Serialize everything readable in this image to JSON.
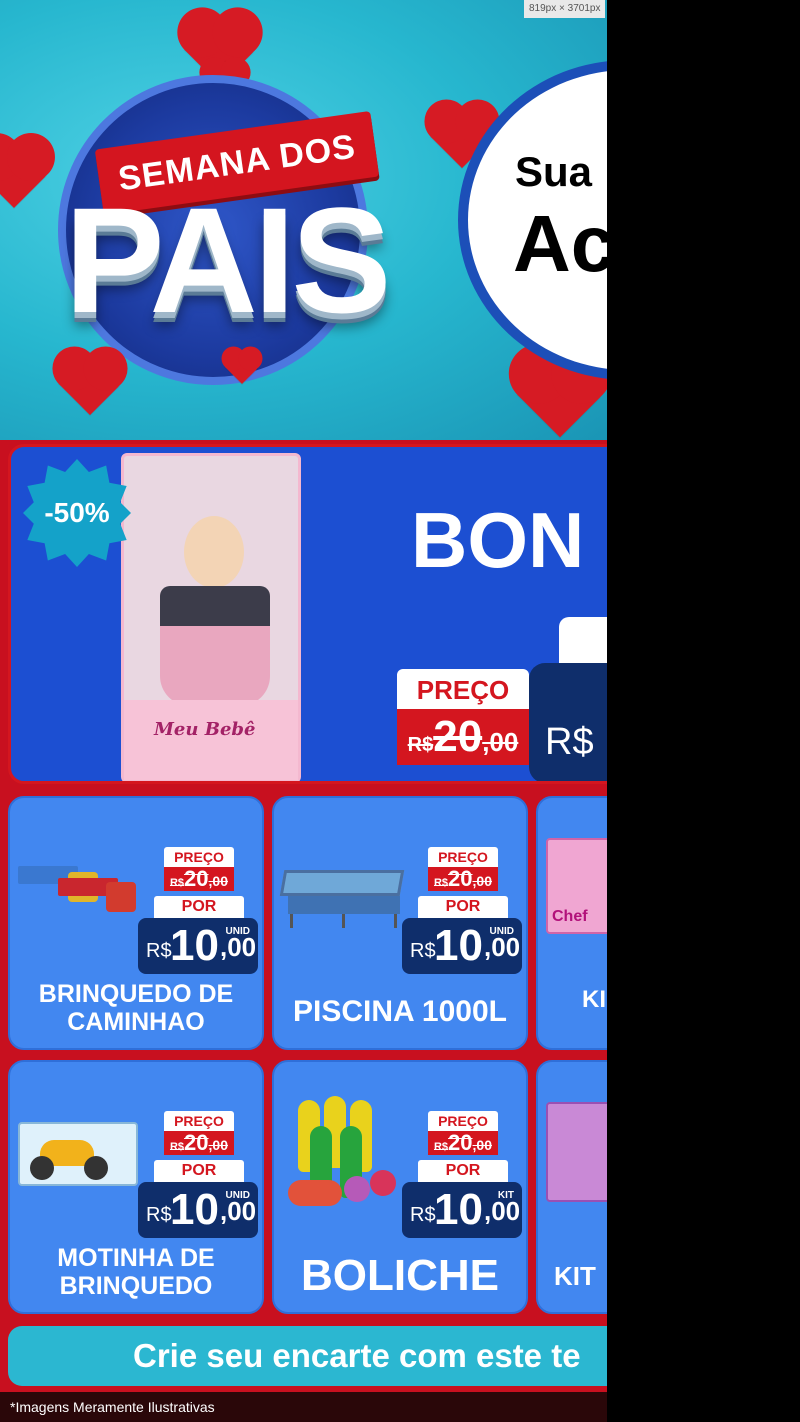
{
  "viewer": {
    "dimensions_label": "819px × 3701px"
  },
  "header": {
    "logo_banner": "SEMANA DOS",
    "logo_main": "PAIS",
    "circle_line1": "Sua",
    "circle_line2": "Ac"
  },
  "featured": {
    "discount": "-50%",
    "box_label": "Meu Bebê",
    "name": "BON",
    "preco_label": "PREÇO",
    "old_currency": "R$",
    "old_price": "20",
    "old_cents": ",00",
    "new_currency": "R$"
  },
  "products": [
    {
      "title": "BRINQUEDO DE CAMINHAO",
      "preco": "PREÇO",
      "old_currency": "R$",
      "old_price": "20",
      "old_cents": ",00",
      "por": "POR",
      "new_currency": "R$",
      "new_price": "10",
      "new_cents": ",00",
      "unit": "UNID"
    },
    {
      "title": "PISCINA 1000L",
      "preco": "PREÇO",
      "old_currency": "R$",
      "old_price": "20",
      "old_cents": ",00",
      "por": "POR",
      "new_currency": "R$",
      "new_price": "10",
      "new_cents": ",00",
      "unit": "UNID"
    },
    {
      "title": "KI",
      "box_label": "Chef"
    },
    {
      "title": "MOTINHA DE BRINQUEDO",
      "preco": "PREÇO",
      "old_currency": "R$",
      "old_price": "20",
      "old_cents": ",00",
      "por": "POR",
      "new_currency": "R$",
      "new_price": "10",
      "new_cents": ",00",
      "unit": "UNID"
    },
    {
      "title": "BOLICHE",
      "preco": "PREÇO",
      "old_currency": "R$",
      "old_price": "20",
      "old_cents": ",00",
      "por": "POR",
      "new_currency": "R$",
      "new_price": "10",
      "new_cents": ",00",
      "unit": "KIT"
    },
    {
      "title": "KIT"
    }
  ],
  "cta": {
    "label": "Crie seu encarte com este te"
  },
  "footer": {
    "disclaimer": "*Imagens Meramente Ilustrativas"
  },
  "colors": {
    "brand_red": "#d4161f",
    "brand_blue": "#1c4fd2",
    "card_blue": "#4287f0",
    "price_navy": "#0f2e6b",
    "cta_teal": "#2bb7d1"
  }
}
